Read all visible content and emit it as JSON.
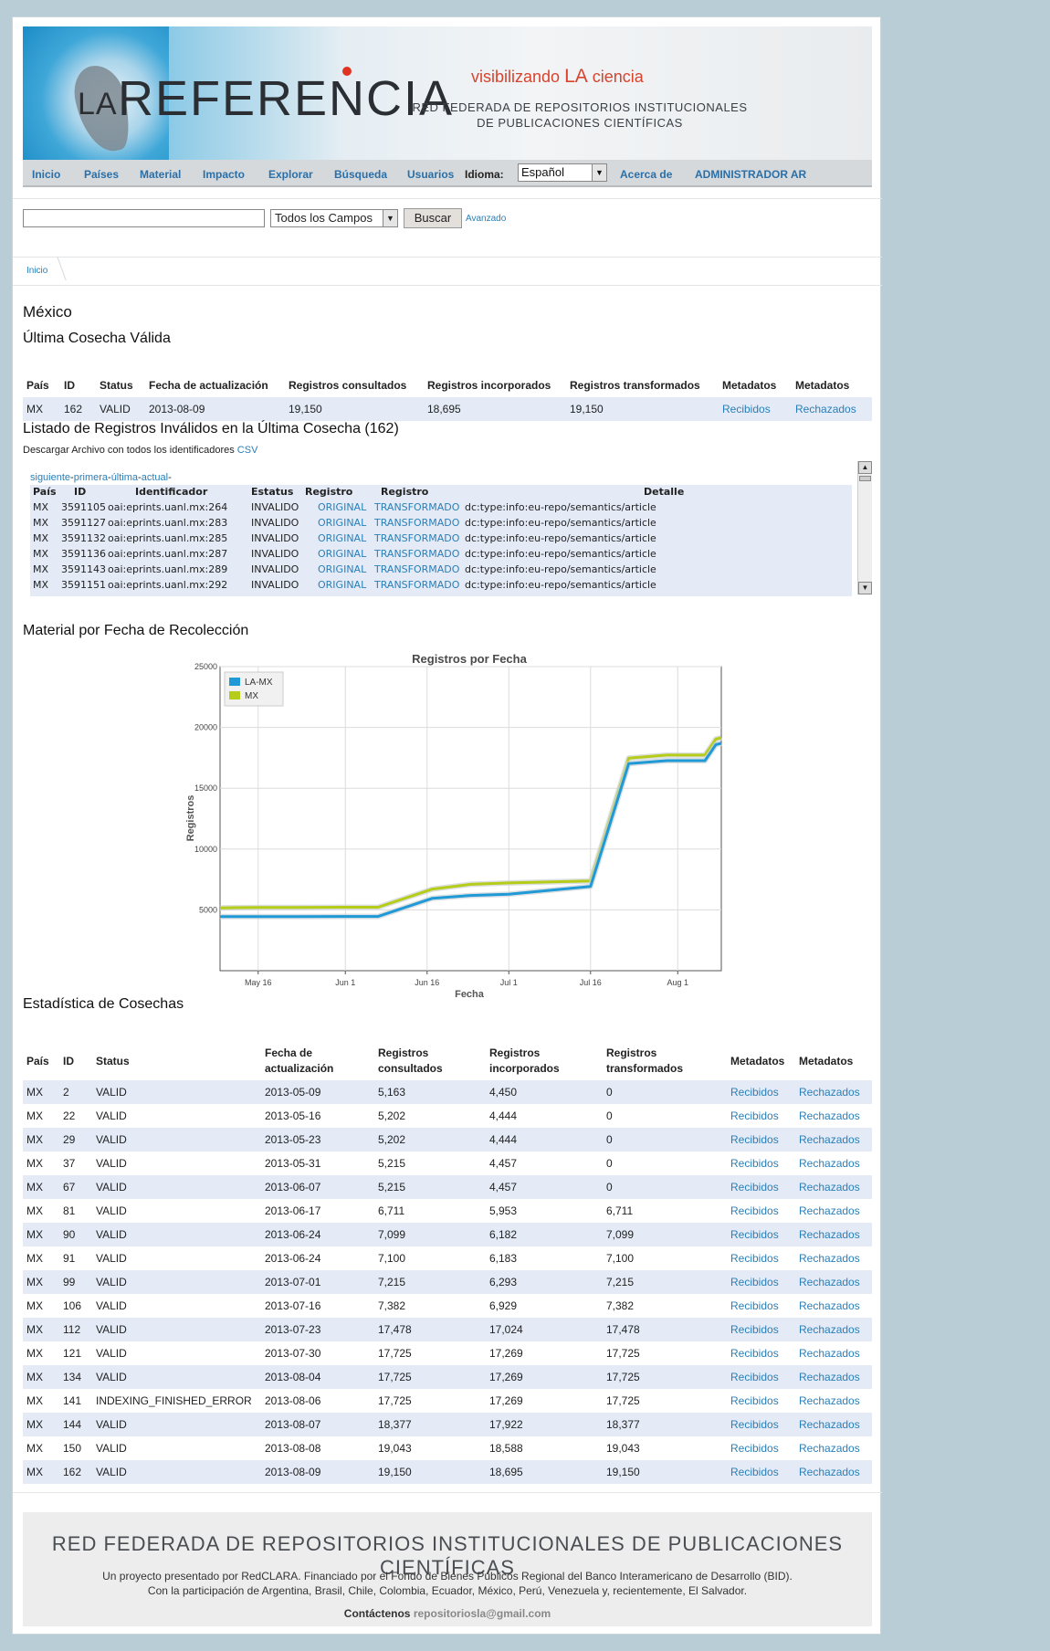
{
  "header": {
    "logo_la": "LA",
    "logo_ref": "REFERENCIA",
    "tagline_pre": "visibilizando",
    "tagline_la": "LA",
    "tagline_post": "ciencia",
    "subtitle_1": "RED FEDERADA DE REPOSITORIOS INSTITUCIONALES",
    "subtitle_2": "DE PUBLICACIONES CIENTÍFICAS"
  },
  "nav": {
    "items": [
      "Inicio",
      "Países",
      "Material",
      "Impacto",
      "Explorar",
      "Búsqueda",
      "Usuarios"
    ],
    "idioma_label": "Idioma:",
    "idioma_value": "Español",
    "acerca": "Acerca de",
    "admin": "ADMINISTRADOR AR"
  },
  "search": {
    "field_value": "",
    "scope": "Todos los Campos",
    "button": "Buscar",
    "advanced": "Avanzado"
  },
  "breadcrumb": "Inicio",
  "country_title": "México",
  "last_harvest": {
    "title": "Última Cosecha Válida",
    "headers": [
      "País",
      "ID",
      "Status",
      "Fecha de actualización",
      "Registros consultados",
      "Registros incorporados",
      "Registros transformados",
      "Metadatos",
      "Metadatos"
    ],
    "row": [
      "MX",
      "162",
      "VALID",
      "2013-08-09",
      "19,150",
      "18,695",
      "19,150",
      "Recibidos",
      "Rechazados"
    ]
  },
  "invalid": {
    "title": "Listado de Registros Inválidos en la Última Cosecha (162)",
    "download_text": "Descargar Archivo con todos los identificadores",
    "download_link": "CSV",
    "pager": [
      "siguiente",
      "primera",
      "última",
      "actual"
    ],
    "headers": [
      "País",
      "ID",
      "Identificador",
      "Estatus",
      "Registro",
      "Registro",
      "Detalle"
    ],
    "rows": [
      [
        "MX",
        "3591105",
        "oai:eprints.uanl.mx:264",
        "INVALIDO",
        "ORIGINAL",
        "TRANSFORMADO",
        "dc:type:info:eu-repo/semantics/article"
      ],
      [
        "MX",
        "3591127",
        "oai:eprints.uanl.mx:283",
        "INVALIDO",
        "ORIGINAL",
        "TRANSFORMADO",
        "dc:type:info:eu-repo/semantics/article"
      ],
      [
        "MX",
        "3591132",
        "oai:eprints.uanl.mx:285",
        "INVALIDO",
        "ORIGINAL",
        "TRANSFORMADO",
        "dc:type:info:eu-repo/semantics/article"
      ],
      [
        "MX",
        "3591136",
        "oai:eprints.uanl.mx:287",
        "INVALIDO",
        "ORIGINAL",
        "TRANSFORMADO",
        "dc:type:info:eu-repo/semantics/article"
      ],
      [
        "MX",
        "3591143",
        "oai:eprints.uanl.mx:289",
        "INVALIDO",
        "ORIGINAL",
        "TRANSFORMADO",
        "dc:type:info:eu-repo/semantics/article"
      ],
      [
        "MX",
        "3591151",
        "oai:eprints.uanl.mx:292",
        "INVALIDO",
        "ORIGINAL",
        "TRANSFORMADO",
        "dc:type:info:eu-repo/semantics/article"
      ]
    ]
  },
  "material_title": "Material por Fecha de Recolección",
  "chart_data": {
    "type": "line",
    "title": "Registros por Fecha",
    "xlabel": "Fecha",
    "ylabel": "Registros",
    "x_ticks": [
      "May 16",
      "Jun 1",
      "Jun 16",
      "Jul 1",
      "Jul 16",
      "Aug 1"
    ],
    "y_ticks": [
      5000,
      10000,
      15000,
      20000,
      25000
    ],
    "ylim": [
      0,
      25000
    ],
    "xlim": [
      "2013-05-09",
      "2013-08-09"
    ],
    "legend_position": "top-left",
    "grid": true,
    "series": [
      {
        "name": "LA-MX",
        "color": "#1f9ad6",
        "x": [
          "2013-05-09",
          "2013-05-16",
          "2013-05-23",
          "2013-05-31",
          "2013-06-07",
          "2013-06-17",
          "2013-06-24",
          "2013-07-01",
          "2013-07-16",
          "2013-07-23",
          "2013-07-30",
          "2013-08-04",
          "2013-08-06",
          "2013-08-07",
          "2013-08-08",
          "2013-08-09"
        ],
        "y": [
          4450,
          4444,
          4444,
          4457,
          4457,
          5953,
          6183,
          6293,
          6929,
          17024,
          17269,
          17269,
          17269,
          17922,
          18588,
          18695
        ]
      },
      {
        "name": "MX",
        "color": "#b5cc18",
        "x": [
          "2013-05-09",
          "2013-05-16",
          "2013-05-23",
          "2013-05-31",
          "2013-06-07",
          "2013-06-17",
          "2013-06-24",
          "2013-07-01",
          "2013-07-16",
          "2013-07-23",
          "2013-07-30",
          "2013-08-04",
          "2013-08-06",
          "2013-08-07",
          "2013-08-08",
          "2013-08-09"
        ],
        "y": [
          5163,
          5202,
          5202,
          5215,
          5215,
          6711,
          7100,
          7215,
          7382,
          17478,
          17725,
          17725,
          17725,
          18377,
          19043,
          19150
        ]
      }
    ]
  },
  "stats": {
    "title": "Estadística de Cosechas",
    "headers": [
      "País",
      "ID",
      "Status",
      "Fecha de actualización",
      "Registros consultados",
      "Registros incorporados",
      "Registros transformados",
      "Metadatos",
      "Metadatos"
    ],
    "rows": [
      [
        "MX",
        "2",
        "VALID",
        "2013-05-09",
        "5,163",
        "4,450",
        "0",
        "Recibidos",
        "Rechazados"
      ],
      [
        "MX",
        "22",
        "VALID",
        "2013-05-16",
        "5,202",
        "4,444",
        "0",
        "Recibidos",
        "Rechazados"
      ],
      [
        "MX",
        "29",
        "VALID",
        "2013-05-23",
        "5,202",
        "4,444",
        "0",
        "Recibidos",
        "Rechazados"
      ],
      [
        "MX",
        "37",
        "VALID",
        "2013-05-31",
        "5,215",
        "4,457",
        "0",
        "Recibidos",
        "Rechazados"
      ],
      [
        "MX",
        "67",
        "VALID",
        "2013-06-07",
        "5,215",
        "4,457",
        "0",
        "Recibidos",
        "Rechazados"
      ],
      [
        "MX",
        "81",
        "VALID",
        "2013-06-17",
        "6,711",
        "5,953",
        "6,711",
        "Recibidos",
        "Rechazados"
      ],
      [
        "MX",
        "90",
        "VALID",
        "2013-06-24",
        "7,099",
        "6,182",
        "7,099",
        "Recibidos",
        "Rechazados"
      ],
      [
        "MX",
        "91",
        "VALID",
        "2013-06-24",
        "7,100",
        "6,183",
        "7,100",
        "Recibidos",
        "Rechazados"
      ],
      [
        "MX",
        "99",
        "VALID",
        "2013-07-01",
        "7,215",
        "6,293",
        "7,215",
        "Recibidos",
        "Rechazados"
      ],
      [
        "MX",
        "106",
        "VALID",
        "2013-07-16",
        "7,382",
        "6,929",
        "7,382",
        "Recibidos",
        "Rechazados"
      ],
      [
        "MX",
        "112",
        "VALID",
        "2013-07-23",
        "17,478",
        "17,024",
        "17,478",
        "Recibidos",
        "Rechazados"
      ],
      [
        "MX",
        "121",
        "VALID",
        "2013-07-30",
        "17,725",
        "17,269",
        "17,725",
        "Recibidos",
        "Rechazados"
      ],
      [
        "MX",
        "134",
        "VALID",
        "2013-08-04",
        "17,725",
        "17,269",
        "17,725",
        "Recibidos",
        "Rechazados"
      ],
      [
        "MX",
        "141",
        "INDEXING_FINISHED_ERROR",
        "2013-08-06",
        "17,725",
        "17,269",
        "17,725",
        "Recibidos",
        "Rechazados"
      ],
      [
        "MX",
        "144",
        "VALID",
        "2013-08-07",
        "18,377",
        "17,922",
        "18,377",
        "Recibidos",
        "Rechazados"
      ],
      [
        "MX",
        "150",
        "VALID",
        "2013-08-08",
        "19,043",
        "18,588",
        "19,043",
        "Recibidos",
        "Rechazados"
      ],
      [
        "MX",
        "162",
        "VALID",
        "2013-08-09",
        "19,150",
        "18,695",
        "19,150",
        "Recibidos",
        "Rechazados"
      ]
    ]
  },
  "footer": {
    "title": "RED FEDERADA DE REPOSITORIOS INSTITUCIONALES DE PUBLICACIONES CIENTÍFICAS",
    "line1": "Un proyecto presentado por RedCLARA. Financiado por el Fondo de Bienes Públicos Regional del Banco Interamericano de Desarrollo (BID).",
    "line2": "Con la participación de Argentina, Brasil, Chile, Colombia, Ecuador, México, Perú, Venezuela y, recientemente, El Salvador.",
    "contact_label": "Contáctenos",
    "contact_email": "repositoriosla@gmail.com"
  }
}
